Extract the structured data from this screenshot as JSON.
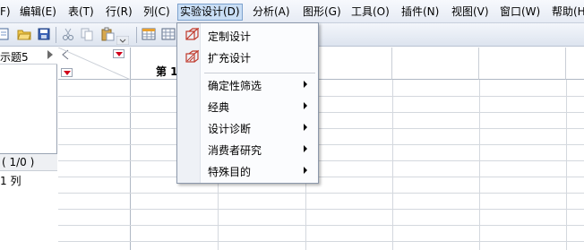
{
  "menubar": {
    "items": [
      "F)",
      "编辑(E)",
      "表(T)",
      "行(R)",
      "列(C)",
      "实验设计(D)",
      "分析(A)",
      "图形(G)",
      "工具(O)",
      "插件(N)",
      "视图(V)",
      "窗口(W)",
      "帮助(H"
    ]
  },
  "toolbar": {
    "icons": [
      "new-icon",
      "open-icon",
      "save-icon",
      "cut-icon",
      "copy-icon",
      "paste-icon",
      "table-icon",
      "data-grid-icon"
    ]
  },
  "left_panel": {
    "title": "示题5",
    "columns_header": "( 1/0 )",
    "columns_count": "1 列"
  },
  "grid": {
    "column_header": "第 1"
  },
  "dropdown": {
    "items": [
      {
        "label": "定制设计",
        "submenu": false,
        "icon": "custom-design-icon"
      },
      {
        "label": "扩充设计",
        "submenu": false,
        "icon": "augment-design-icon"
      },
      {
        "label": "确定性筛选",
        "submenu": true
      },
      {
        "label": "经典",
        "submenu": true
      },
      {
        "label": "设计诊断",
        "submenu": true
      },
      {
        "label": "消费者研究",
        "submenu": true
      },
      {
        "label": "特殊目的",
        "submenu": true
      }
    ]
  },
  "colors": {
    "menu_active_bg": "#c9def5",
    "accent_red": "#d0021b"
  }
}
